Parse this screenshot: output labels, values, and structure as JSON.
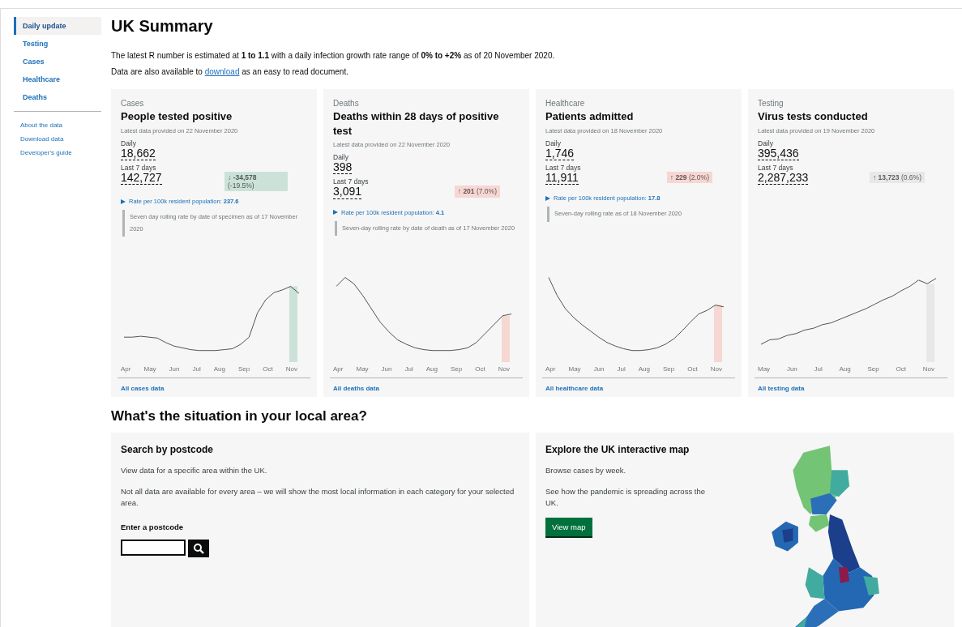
{
  "sidebar": {
    "items": [
      {
        "label": "Daily update",
        "selected": true
      },
      {
        "label": "Testing",
        "selected": false
      },
      {
        "label": "Cases",
        "selected": false
      },
      {
        "label": "Healthcare",
        "selected": false
      },
      {
        "label": "Deaths",
        "selected": false
      }
    ],
    "links": [
      "About the data",
      "Download data",
      "Developer's guide"
    ]
  },
  "title": "UK Summary",
  "intro": "The latest R number is estimated at **1 to 1.1** with a daily infection growth rate range of **0% to +2%** as of 20 November 2020.",
  "download_note": {
    "before": "Data are also available to",
    "link": "download",
    "after": "as an easy to read document."
  },
  "cards": [
    {
      "category": "Cases",
      "title": "People tested positive",
      "updated": "Latest data provided on 22 November 2020",
      "daily_label": "Daily",
      "daily": "18,662",
      "week_label": "Last 7 days",
      "week": "142,727",
      "change": {
        "arrow": "↓",
        "value": "-34,578",
        "percent": "(-19.5%)",
        "color": "#cce2d8"
      },
      "rate": {
        "label": "Rate per 100k resident population:",
        "value": "237.6"
      },
      "note": "Seven day rolling rate by date of specimen as of 17 November 2020",
      "months": [
        "Apr",
        "May",
        "Jun",
        "Jul",
        "Aug",
        "Sep",
        "Oct",
        "Nov"
      ],
      "link": "All cases data"
    },
    {
      "category": "Deaths",
      "title": "Deaths within 28 days of positive test",
      "updated": "Latest data provided on 22 November 2020",
      "daily_label": "Daily",
      "daily": "398",
      "week_label": "Last 7 days",
      "week": "3,091",
      "change": {
        "arrow": "↑",
        "value": "201",
        "percent": "(7.0%)",
        "color": "#f6d7d2"
      },
      "rate": {
        "label": "Rate per 100k resident population:",
        "value": "4.1"
      },
      "note": "Seven-day rolling rate by date of death as of 17 November 2020",
      "months": [
        "Apr",
        "May",
        "Jun",
        "Jul",
        "Aug",
        "Sep",
        "Oct",
        "Nov"
      ],
      "link": "All deaths data"
    },
    {
      "category": "Healthcare",
      "title": "Patients admitted",
      "updated": "Latest data provided on 18 November 2020",
      "daily_label": "Daily",
      "daily": "1,746",
      "week_label": "Last 7 days",
      "week": "11,911",
      "change": {
        "arrow": "↑",
        "value": "229",
        "percent": "(2.0%)",
        "color": "#f6d7d2"
      },
      "rate": {
        "label": "Rate per 100k resident population:",
        "value": "17.8"
      },
      "note": "Seven-day rolling rate as of 18 November 2020",
      "months": [
        "Apr",
        "May",
        "Jun",
        "Jul",
        "Aug",
        "Sep",
        "Oct",
        "Nov"
      ],
      "link": "All healthcare data"
    },
    {
      "category": "Testing",
      "title": "Virus tests conducted",
      "updated": "Latest data provided on 19 November 2020",
      "daily_label": "Daily",
      "daily": "395,436",
      "week_label": "Last 7 days",
      "week": "2,287,233",
      "change": {
        "arrow": "↑",
        "value": "13,723",
        "percent": "(0.6%)",
        "color": "#e8e8e8"
      },
      "months": [
        "May",
        "Jun",
        "Jul",
        "Aug",
        "Sep",
        "Oct",
        "Nov"
      ],
      "link": "All testing data"
    }
  ],
  "local_title": "What's the situation in your local area?",
  "postcode": {
    "title": "Search by postcode",
    "paragraphs": [
      "View data for a specific area within the UK.",
      "Not all data are available for every area – we will show the most local information in each category for your selected area."
    ],
    "field_label": "Enter a postcode"
  },
  "map": {
    "title": "Explore the UK interactive map",
    "paragraphs": [
      "Browse cases by week.",
      "See how the pandemic is spreading across the UK."
    ],
    "button": "View map"
  }
}
